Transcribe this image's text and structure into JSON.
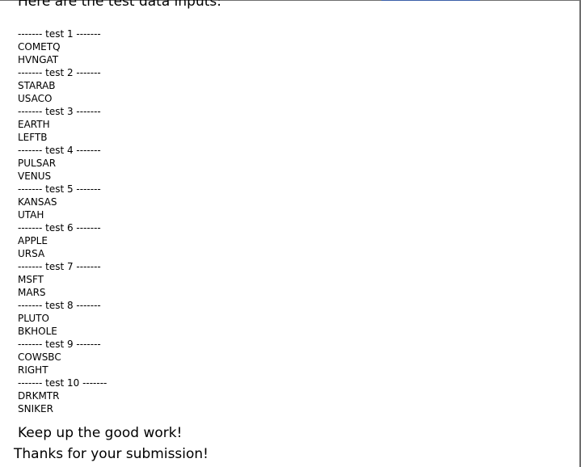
{
  "heading": "Here are the test data inputs:",
  "tests": [
    {
      "label": "------- test 1 -------",
      "inputs": [
        "COMETQ",
        "HVNGAT"
      ]
    },
    {
      "label": "------- test 2 -------",
      "inputs": [
        "STARAB",
        "USACO"
      ]
    },
    {
      "label": "------- test 3 -------",
      "inputs": [
        "EARTH",
        "LEFTB"
      ]
    },
    {
      "label": "------- test 4 -------",
      "inputs": [
        "PULSAR",
        "VENUS"
      ]
    },
    {
      "label": "------- test 5 -------",
      "inputs": [
        "KANSAS",
        "UTAH"
      ]
    },
    {
      "label": "------- test 6 -------",
      "inputs": [
        "APPLE",
        "URSA"
      ]
    },
    {
      "label": "------- test 7 -------",
      "inputs": [
        "MSFT",
        "MARS"
      ]
    },
    {
      "label": "------- test 8 -------",
      "inputs": [
        "PLUTO",
        "BKHOLE"
      ]
    },
    {
      "label": "------- test 9 -------",
      "inputs": [
        "COWSBC",
        "RIGHT"
      ]
    },
    {
      "label": "------- test 10 -------",
      "inputs": [
        "DRKMTR",
        "SNIKER"
      ]
    }
  ],
  "encouragement": "Keep up the good work!",
  "thanks": "Thanks for your submission!"
}
